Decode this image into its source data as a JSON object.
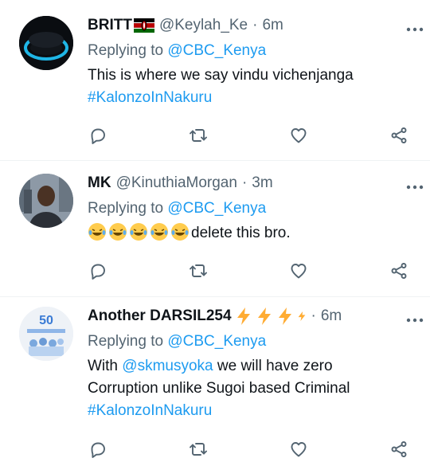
{
  "tweets": [
    {
      "name": "BRITT",
      "handle": "@Keylah_Ke",
      "dot": "·",
      "time": "6m",
      "replying_label": "Replying to",
      "replying_to": "@CBC_Kenya",
      "text_lines": [
        "This is where we say vindu vichenjanga"
      ],
      "hashtag": "#KalonzoInNakuru"
    },
    {
      "name": "MK",
      "handle": "@KinuthiaMorgan",
      "dot": "·",
      "time": "3m",
      "replying_label": "Replying to",
      "replying_to": "@CBC_Kenya",
      "text_after_emoji": "delete this bro."
    },
    {
      "name": "Another DARSIL254",
      "dot": "·",
      "time": "6m",
      "replying_label": "Replying to",
      "replying_to": "@CBC_Kenya",
      "text_prefix": "With",
      "mention": "@skmusyoka",
      "text_line1_rest": " we will have zero",
      "text_line2": "Corruption unlike Sugoi based Criminal",
      "hashtag": "#KalonzoInNakuru",
      "avatar_text": "50"
    }
  ],
  "icons": {
    "reply": "reply-icon",
    "retweet": "retweet-icon",
    "like": "like-icon",
    "share": "share-icon",
    "more": "more-icon"
  },
  "colors": {
    "link": "#1d9bf0",
    "muted": "#536471",
    "text": "#0f1419"
  }
}
